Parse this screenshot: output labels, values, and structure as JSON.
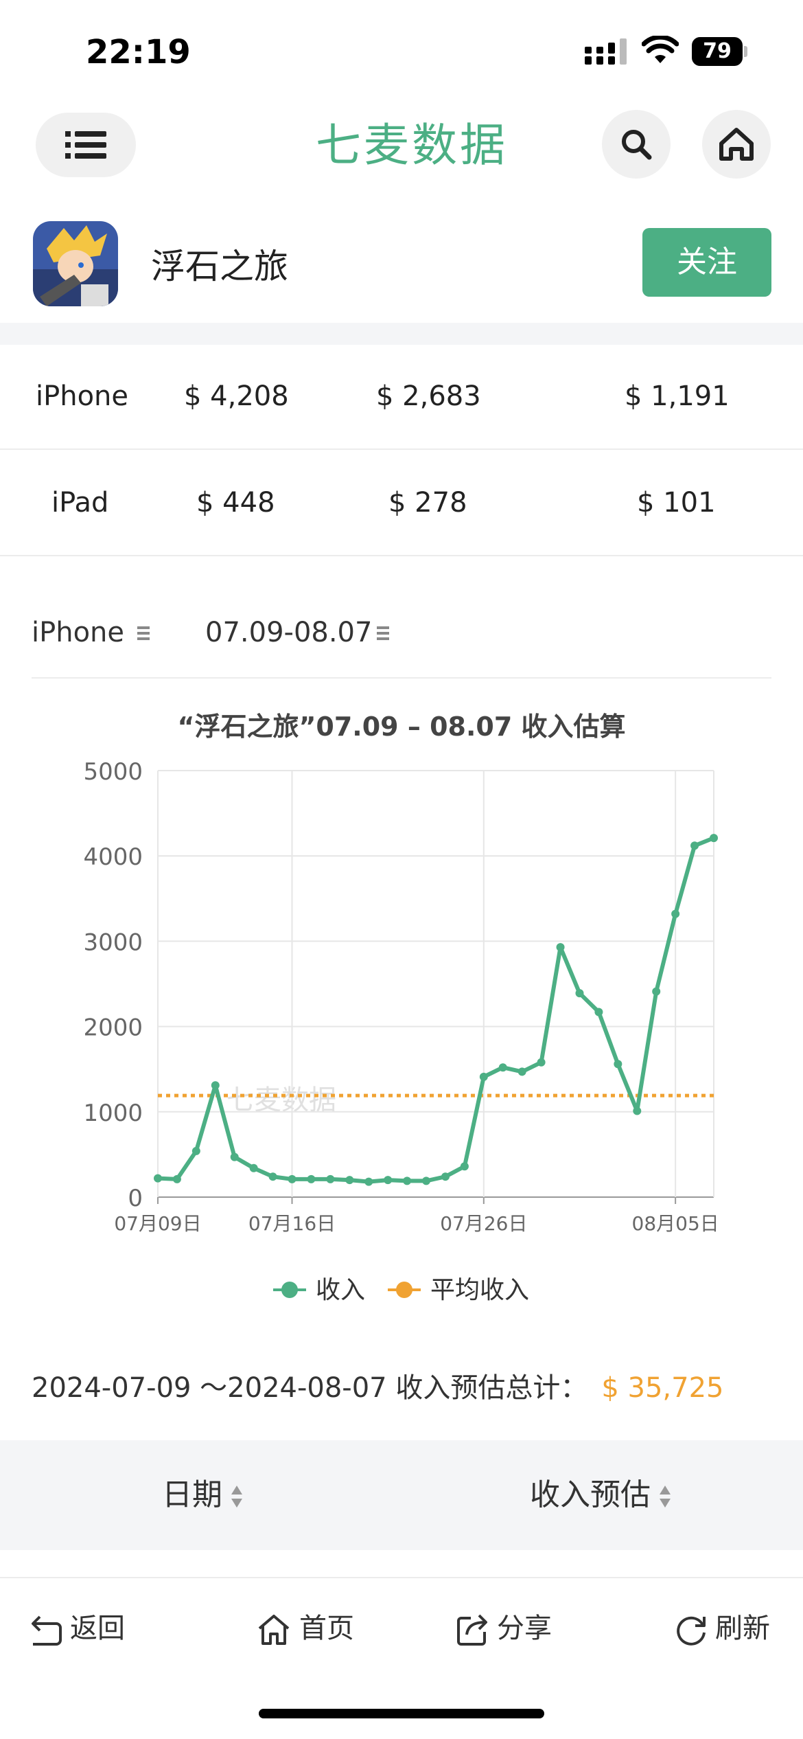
{
  "status": {
    "time": "22:19",
    "battery": "79"
  },
  "header": {
    "logo": "七麦数据",
    "icons": [
      "menu-icon",
      "search-icon",
      "home-icon"
    ]
  },
  "app": {
    "name": "浮石之旅",
    "follow_label": "关注"
  },
  "device_table": [
    {
      "device": "iPhone",
      "v1": "$ 4,208",
      "v2": "$ 2,683",
      "v3": "$ 1,191"
    },
    {
      "device": "iPad",
      "v1": "$ 448",
      "v2": "$ 278",
      "v3": "$ 101"
    }
  ],
  "selectors": {
    "device": "iPhone",
    "range": "07.09-08.07"
  },
  "chart_data": {
    "type": "line",
    "title": "“浮石之旅”07.09 – 08.07 收入估算",
    "x": [
      "07-09",
      "07-10",
      "07-11",
      "07-12",
      "07-13",
      "07-14",
      "07-15",
      "07-16",
      "07-17",
      "07-18",
      "07-19",
      "07-20",
      "07-21",
      "07-22",
      "07-23",
      "07-24",
      "07-25",
      "07-26",
      "07-27",
      "07-28",
      "07-29",
      "07-30",
      "07-31",
      "08-01",
      "08-02",
      "08-03",
      "08-04",
      "08-05",
      "08-06",
      "08-07"
    ],
    "xtick_labels": [
      "07月09日",
      "07月16日",
      "07月26日",
      "08月05日"
    ],
    "xtick_index": [
      0,
      7,
      17,
      27
    ],
    "yticks": [
      "0",
      "1000",
      "2000",
      "3000",
      "4000",
      "5000"
    ],
    "ylim": [
      0,
      5000
    ],
    "series": [
      {
        "name": "收入",
        "color": "#4caf84",
        "values": [
          220,
          210,
          540,
          1310,
          470,
          340,
          240,
          210,
          210,
          210,
          200,
          180,
          200,
          190,
          190,
          240,
          360,
          1410,
          1520,
          1470,
          1580,
          2930,
          2390,
          2170,
          1560,
          1010,
          2410,
          3320,
          4120,
          4210
        ]
      },
      {
        "name": "平均收入",
        "color": "#f0a232",
        "values": [
          1191
        ]
      }
    ],
    "legend": "bottom",
    "grid": true,
    "watermark": "七麦数据"
  },
  "summary": {
    "label": "2024-07-09 ～2024-08-07 收入预估总计：",
    "amount": "$ 35,725"
  },
  "table_header": {
    "date": "日期",
    "revenue": "收入预估"
  },
  "bottom_bar": {
    "back": "返回",
    "home": "首页",
    "share": "分享",
    "refresh": "刷新"
  }
}
